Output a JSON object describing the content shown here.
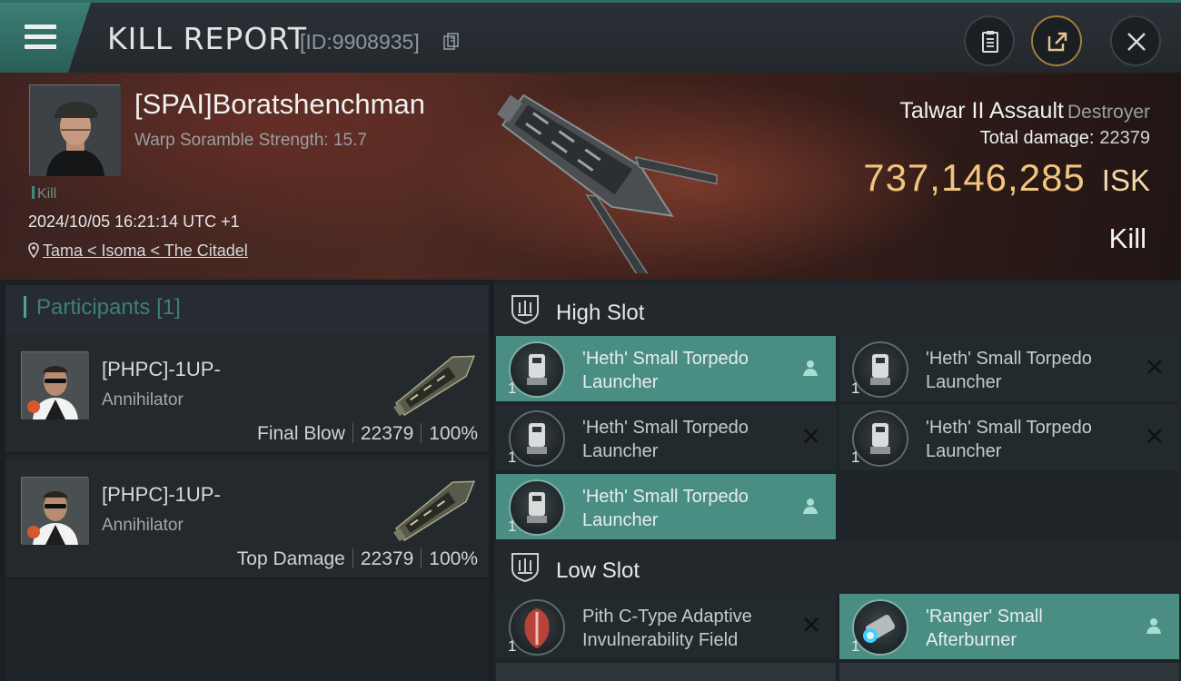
{
  "header": {
    "title": "KILL REPORT",
    "report_id": "[ID:9908935]",
    "buttons": [
      "clipboard-icon",
      "share-icon",
      "close-icon"
    ]
  },
  "victim": {
    "name": "[SPAI]Boratshenchman",
    "warp_scramble": "Warp Soramble Strength: 15.7",
    "kill_tag": "Kill",
    "datetime": "2024/10/05 16:21:14 UTC +1",
    "location": "Tama < Isoma < The Citadel"
  },
  "ship": {
    "name": "Talwar II Assault",
    "class": "Destroyer",
    "damage_label": "Total damage:",
    "damage_value": "22379",
    "isk_value": "737,146,285",
    "isk_unit": "ISK",
    "result": "Kill"
  },
  "participants": {
    "title": "Participants",
    "count": "[1]",
    "items": [
      {
        "name": "[PHPC]-1UP-",
        "ship": "Annihilator",
        "role": "Final Blow",
        "damage": "22379",
        "percent": "100%"
      },
      {
        "name": "[PHPC]-1UP-",
        "ship": "Annihilator",
        "role": "Top Damage",
        "damage": "22379",
        "percent": "100%"
      }
    ]
  },
  "high_slot": {
    "title": "High Slot",
    "modules": [
      {
        "name": "'Heth' Small Torpedo Launcher",
        "qty": "1",
        "status": "fitted"
      },
      {
        "name": "'Heth' Small Torpedo Launcher",
        "qty": "1",
        "status": "destroyed"
      },
      {
        "name": "'Heth' Small Torpedo Launcher",
        "qty": "1",
        "status": "destroyed"
      },
      {
        "name": "'Heth' Small Torpedo Launcher",
        "qty": "1",
        "status": "destroyed"
      },
      {
        "name": "'Heth' Small Torpedo Launcher",
        "qty": "1",
        "status": "fitted"
      }
    ]
  },
  "low_slot": {
    "title": "Low Slot",
    "modules": [
      {
        "name": "Pith C-Type Adaptive Invulnerability Field",
        "qty": "1",
        "status": "destroyed"
      },
      {
        "name": "'Ranger' Small Afterburner",
        "qty": "1",
        "status": "fitted"
      }
    ]
  },
  "colors": {
    "accent_teal": "#4a8d83",
    "isk_gold": "#f1c57e",
    "kill_red": "#c62a2a"
  }
}
